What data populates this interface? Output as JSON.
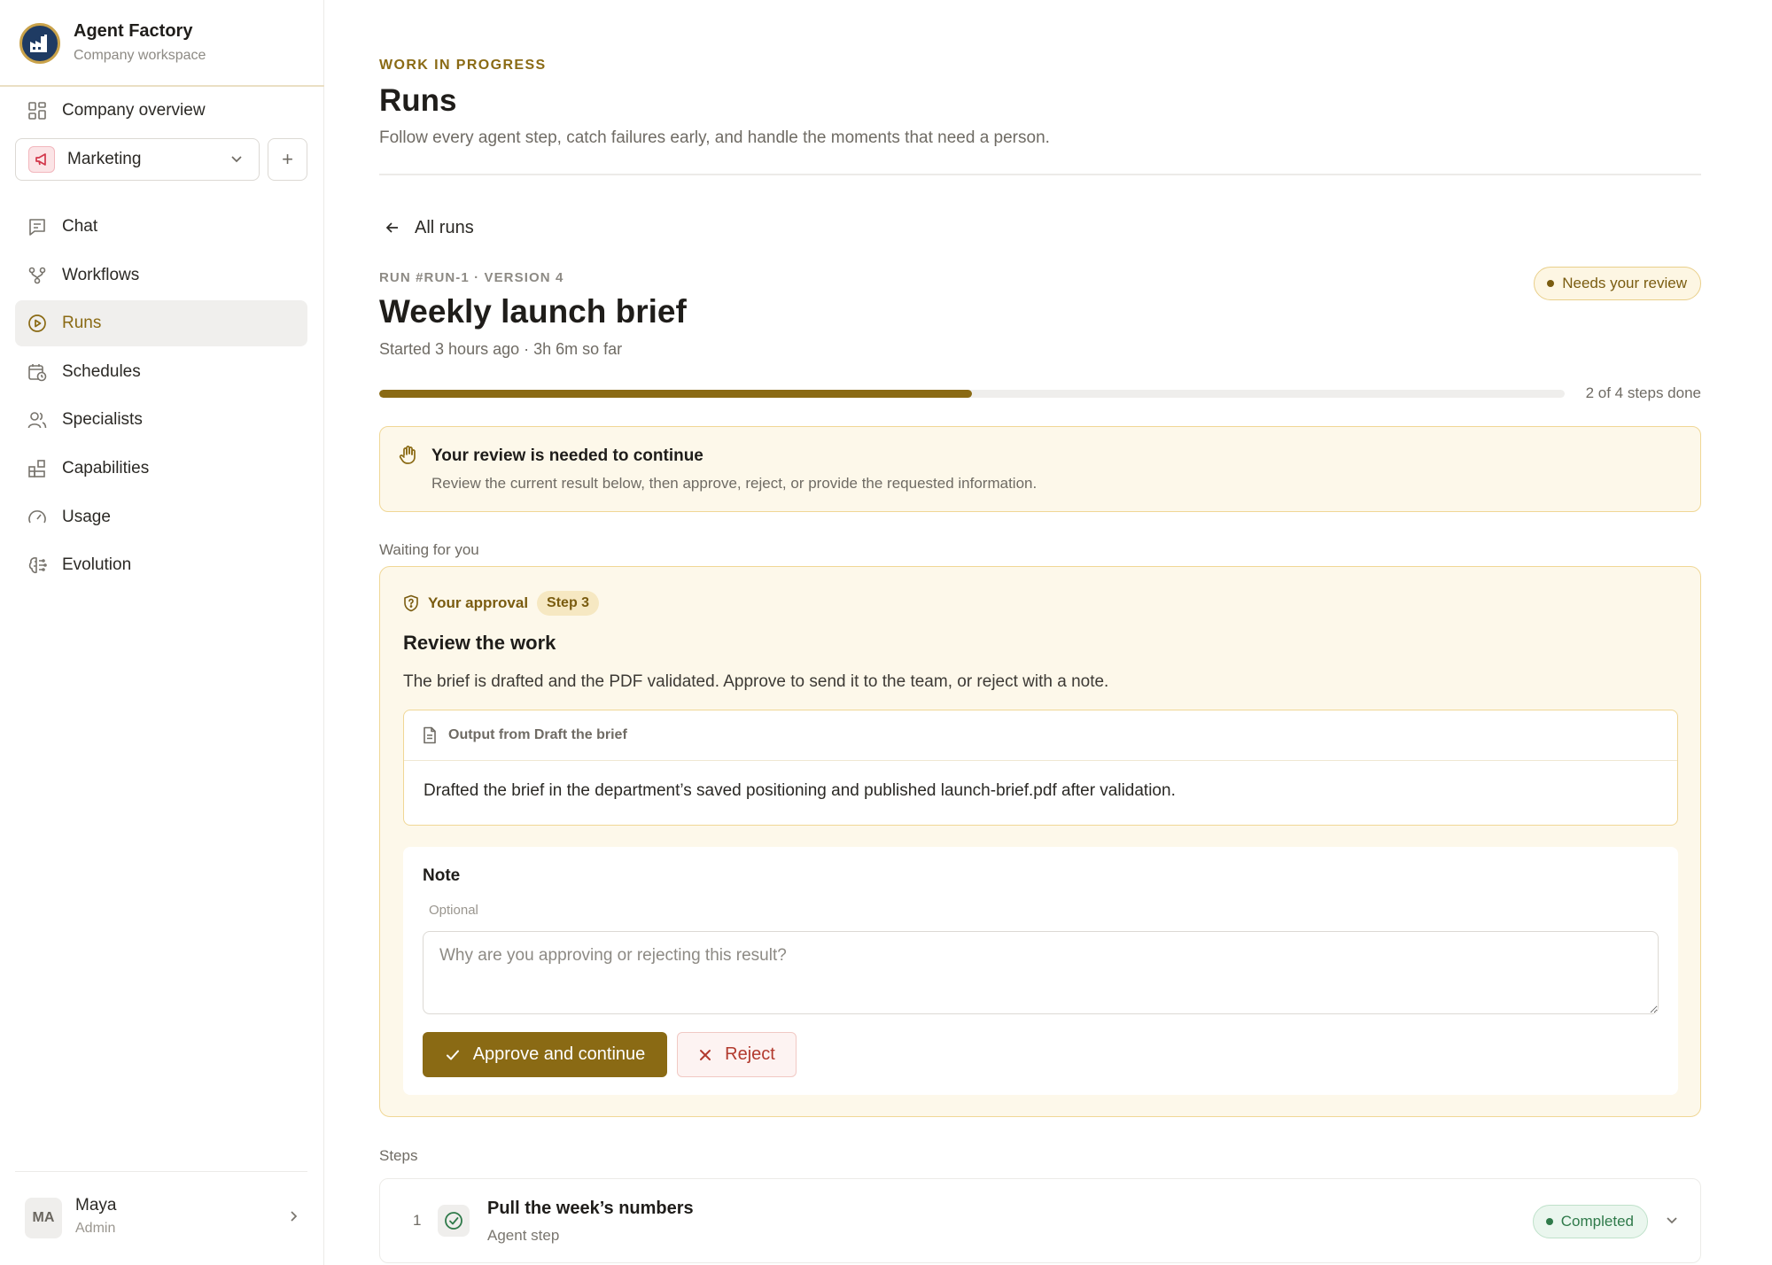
{
  "brand": {
    "name": "Agent Factory",
    "subtitle": "Company workspace"
  },
  "sidebar": {
    "overview_label": "Company overview",
    "department": {
      "name": "Marketing",
      "add_label": "+"
    },
    "items": [
      {
        "label": "Chat",
        "icon": "chat-icon"
      },
      {
        "label": "Workflows",
        "icon": "workflow-icon"
      },
      {
        "label": "Runs",
        "icon": "play-circle-icon",
        "active": true
      },
      {
        "label": "Schedules",
        "icon": "calendar-clock-icon"
      },
      {
        "label": "Specialists",
        "icon": "users-icon"
      },
      {
        "label": "Capabilities",
        "icon": "blocks-icon"
      },
      {
        "label": "Usage",
        "icon": "gauge-icon"
      },
      {
        "label": "Evolution",
        "icon": "brain-icon"
      }
    ],
    "user": {
      "initials": "MA",
      "name": "Maya",
      "role": "Admin"
    }
  },
  "header": {
    "eyebrow": "WORK IN PROGRESS",
    "title": "Runs",
    "description": "Follow every agent step, catch failures early, and handle the moments that need a person."
  },
  "back_link": "All runs",
  "run": {
    "meta": "RUN #RUN-1 · VERSION 4",
    "title": "Weekly launch brief",
    "started": "Started 3 hours ago · 3h 6m so far",
    "status": "Needs your review",
    "progress": {
      "done": 2,
      "total": 4,
      "fraction": 0.5,
      "label": "2 of 4 steps done"
    }
  },
  "review_banner": {
    "title": "Your review is needed to continue",
    "description": "Review the current result below, then approve, reject, or provide the requested information."
  },
  "waiting_label": "Waiting for you",
  "approval": {
    "kind": "Your approval",
    "step_chip": "Step 3",
    "title": "Review the work",
    "description": "The brief is drafted and the PDF validated. Approve to send it to the team, or reject with a note.",
    "output_title": "Output from Draft the brief",
    "output_body": "Drafted the brief in the department’s saved positioning and published launch-brief.pdf after validation.",
    "note_label": "Note",
    "note_optional": "Optional",
    "note_placeholder": "Why are you approving or rejecting this result?",
    "note_value": "",
    "approve_label": "Approve and continue",
    "reject_label": "Reject"
  },
  "steps_label": "Steps",
  "steps": [
    {
      "number": "1",
      "title": "Pull the week’s numbers",
      "subtitle": "Agent step",
      "status": "Completed"
    }
  ],
  "colors": {
    "accent": "#8a6a14",
    "review_bg": "#fdf8ea",
    "review_border": "#f0d796",
    "success": "#2f7a4a",
    "danger": "#b23a2e"
  }
}
